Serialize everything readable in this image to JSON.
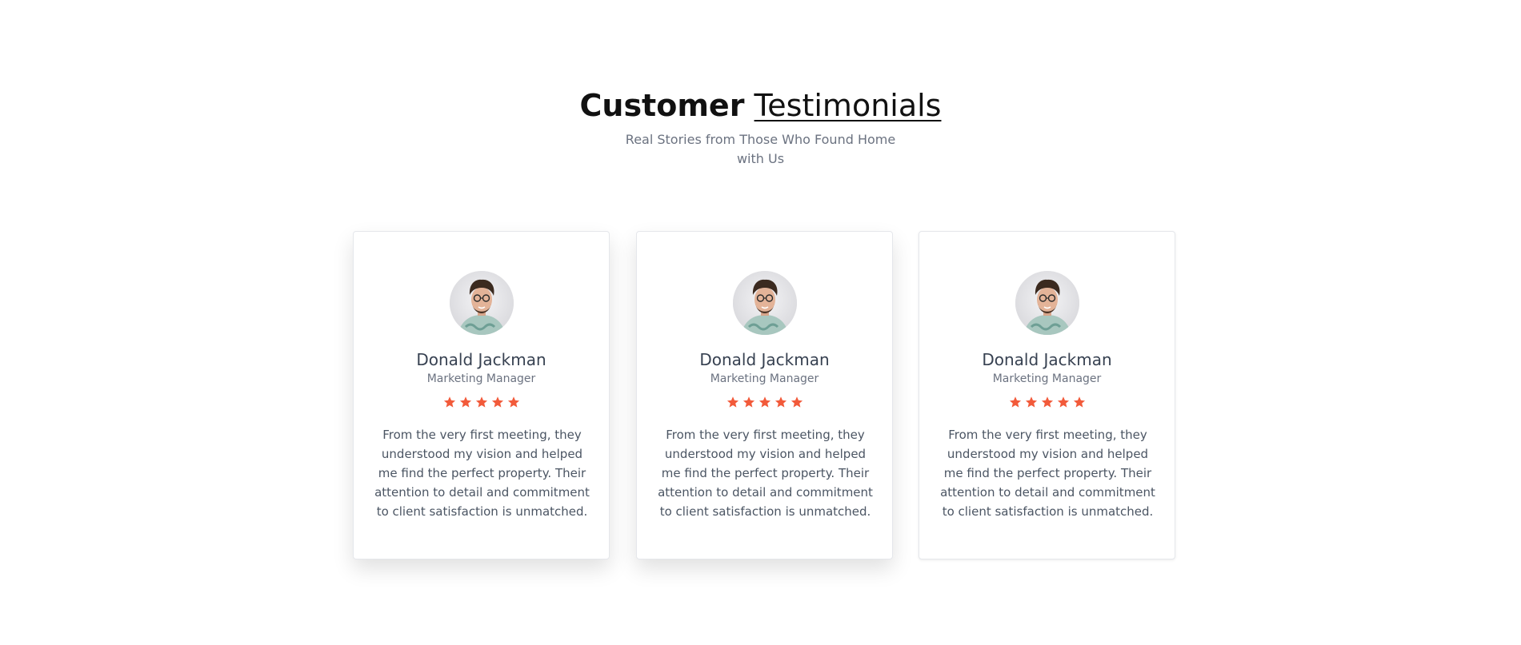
{
  "section": {
    "title_strong": "Customer",
    "title_light": "Testimonials",
    "subtitle_line_1": "Real Stories from Those Who Found Home",
    "subtitle_line_2": "with Us"
  },
  "accent_color": "#f25a3a",
  "testimonials": [
    {
      "name": "Donald Jackman",
      "role": "Marketing Manager",
      "rating": 5,
      "quote": "From the very first meeting, they understood my vision and helped me find the perfect property. Their attention to detail and commitment to client satisfaction is unmatched.",
      "avatar_icon": "profile-photo"
    },
    {
      "name": "Donald Jackman",
      "role": "Marketing Manager",
      "rating": 5,
      "quote": "From the very first meeting, they understood my vision and helped me find the perfect property. Their attention to detail and commitment to client satisfaction is unmatched.",
      "avatar_icon": "profile-photo"
    },
    {
      "name": "Donald Jackman",
      "role": "Marketing Manager",
      "rating": 5,
      "quote": "From the very first meeting, they understood my vision and helped me find the perfect property. Their attention to detail and commitment to client satisfaction is unmatched.",
      "avatar_icon": "profile-photo"
    }
  ]
}
